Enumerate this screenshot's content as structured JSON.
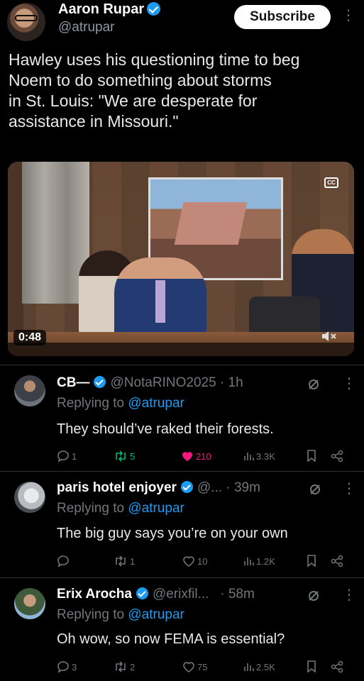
{
  "post": {
    "author_name": "Aaron Rupar",
    "author_handle": "@atrupar",
    "subscribe_label": "Subscribe",
    "text_lines": [
      "Hawley uses his questioning time to beg",
      "Noem to do something about storms",
      "in St. Louis: \"We are desperate for",
      "assistance in Missouri.\""
    ],
    "video": {
      "time": "0:48",
      "cc_label": "CC"
    }
  },
  "replies": [
    {
      "name": "CB—",
      "handle_time": "@NotaRINO2025 · 1h",
      "replying_prefix": "Replying to ",
      "replying_to": "@atrupar",
      "text": "They should’ve raked their forests.",
      "replies": "1",
      "reposts": "5",
      "likes": "210",
      "views": "3.3K",
      "liked": true
    },
    {
      "name": "paris hotel enjoyer",
      "handle_time": "@... · 39m",
      "replying_prefix": "Replying to ",
      "replying_to": "@atrupar",
      "text": "The big guy says you’re on your own",
      "replies": "",
      "reposts": "1",
      "likes": "10",
      "views": "1.2K",
      "liked": false
    },
    {
      "name": "Erix Arocha",
      "handle_time": "@erixfil...   · 58m",
      "replying_prefix": "Replying to ",
      "replying_to": "@atrupar",
      "text": "Oh wow, so now FEMA is essential?",
      "replies": "3",
      "reposts": "2",
      "likes": "75",
      "views": "2.5K",
      "liked": false
    }
  ],
  "colors": {
    "background": "#000000",
    "accent": "#1d9bf0",
    "like": "#f91880",
    "muted": "#71767b"
  }
}
